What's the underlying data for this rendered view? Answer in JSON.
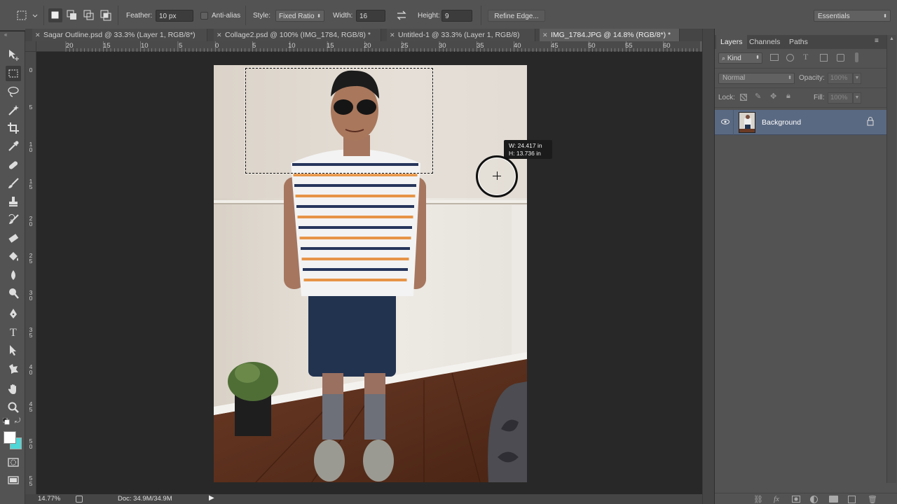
{
  "options_bar": {
    "feather_label": "Feather:",
    "feather_value": "10 px",
    "antialias_label": "Anti-alias",
    "style_label": "Style:",
    "style_value": "Fixed Ratio",
    "width_label": "Width:",
    "width_value": "16",
    "height_label": "Height:",
    "height_value": "9",
    "refine_edge_label": "Refine Edge...",
    "workspace_value": "Essentials"
  },
  "tabs": [
    {
      "label": "Sagar Outline.psd @ 33.3% (Layer 1, RGB/8*)"
    },
    {
      "label": "Collage2.psd @ 100% (IMG_1784, RGB/8) *"
    },
    {
      "label": "Untitled-1 @ 33.3% (Layer 1, RGB/8)"
    },
    {
      "label": "IMG_1784.JPG @ 14.8% (RGB/8*) *"
    }
  ],
  "ruler": {
    "h_labels": [
      "20",
      "15",
      "10",
      "5",
      "0",
      "5",
      "10",
      "15",
      "20",
      "25",
      "30",
      "35",
      "40",
      "45",
      "50",
      "55",
      "60"
    ],
    "v_labels": [
      "0",
      "5",
      "10",
      "15",
      "20",
      "25",
      "30",
      "35",
      "40",
      "45",
      "50",
      "55"
    ]
  },
  "tooltip": {
    "width": "W: 24.417 in",
    "height": "H: 13.736 in"
  },
  "status": {
    "zoom": "14.77%",
    "doc": "Doc: 34.9M/34.9M"
  },
  "layers_panel": {
    "tabs": [
      "Layers",
      "Channels",
      "Paths"
    ],
    "kind_label": "Kind",
    "blend_mode": "Normal",
    "opacity_label": "Opacity:",
    "opacity_value": "100%",
    "lock_label": "Lock:",
    "fill_label": "Fill:",
    "fill_value": "100%",
    "layer_name": "Background"
  }
}
